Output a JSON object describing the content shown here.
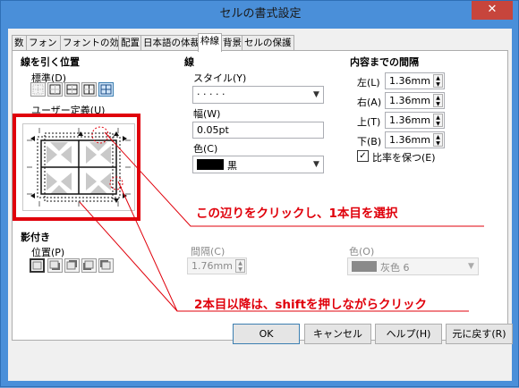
{
  "window": {
    "title": "セルの書式設定",
    "close_glyph": "✕"
  },
  "tabs": [
    {
      "label": "数"
    },
    {
      "label": "フォント"
    },
    {
      "label": "フォントの効果"
    },
    {
      "label": "配置"
    },
    {
      "label": "日本語の体裁"
    },
    {
      "label": "枠線",
      "active": true
    },
    {
      "label": "背景"
    },
    {
      "label": "セルの保護"
    }
  ],
  "line_arrangement": {
    "heading": "線を引く位置",
    "default_label": "標準(D)",
    "default_label_key": "D",
    "user_defined_label": "ユーザー定義(U)",
    "presets": [
      "no-borders-icon",
      "outer-border-icon",
      "outer-inner-horizontal-icon",
      "outer-inner-vertical-icon",
      "all-borders-icon"
    ],
    "selected_preset": 4
  },
  "line": {
    "heading": "線",
    "style_label": "スタイル(Y)",
    "style_value": "· · · · ·",
    "width_label": "幅(W)",
    "width_value": "0.05pt",
    "color_label": "色(C)",
    "color_value": "黒",
    "color_swatch": "#000000"
  },
  "padding": {
    "heading": "内容までの間隔",
    "left_label": "左(L)",
    "left_value": "1.36mm",
    "right_label": "右(A)",
    "right_value": "1.36mm",
    "top_label": "上(T)",
    "top_value": "1.36mm",
    "bottom_label": "下(B)",
    "bottom_value": "1.36mm",
    "sync_label": "比率を保つ(E)",
    "sync_checked": true
  },
  "shadow": {
    "heading": "影付き",
    "position_label": "位置(P)",
    "positions": [
      "no-shadow-icon",
      "shadow-bottom-right-icon",
      "shadow-top-right-icon",
      "shadow-bottom-left-icon",
      "shadow-top-left-icon"
    ],
    "selected_position": 0,
    "distance_label": "間隔(C)",
    "distance_value": "1.76mm",
    "color_label": "色(O)",
    "color_value": "灰色 6",
    "color_swatch": "#808080"
  },
  "annotations": {
    "first": "この辺りをクリックし、1本目を選択",
    "second": "2本目以降は、shiftを押しながらクリック",
    "color": "#e0000b"
  },
  "buttons": {
    "ok": "OK",
    "cancel": "キャンセル",
    "help": "ヘルプ(H)",
    "reset": "元に戻す(R)"
  }
}
